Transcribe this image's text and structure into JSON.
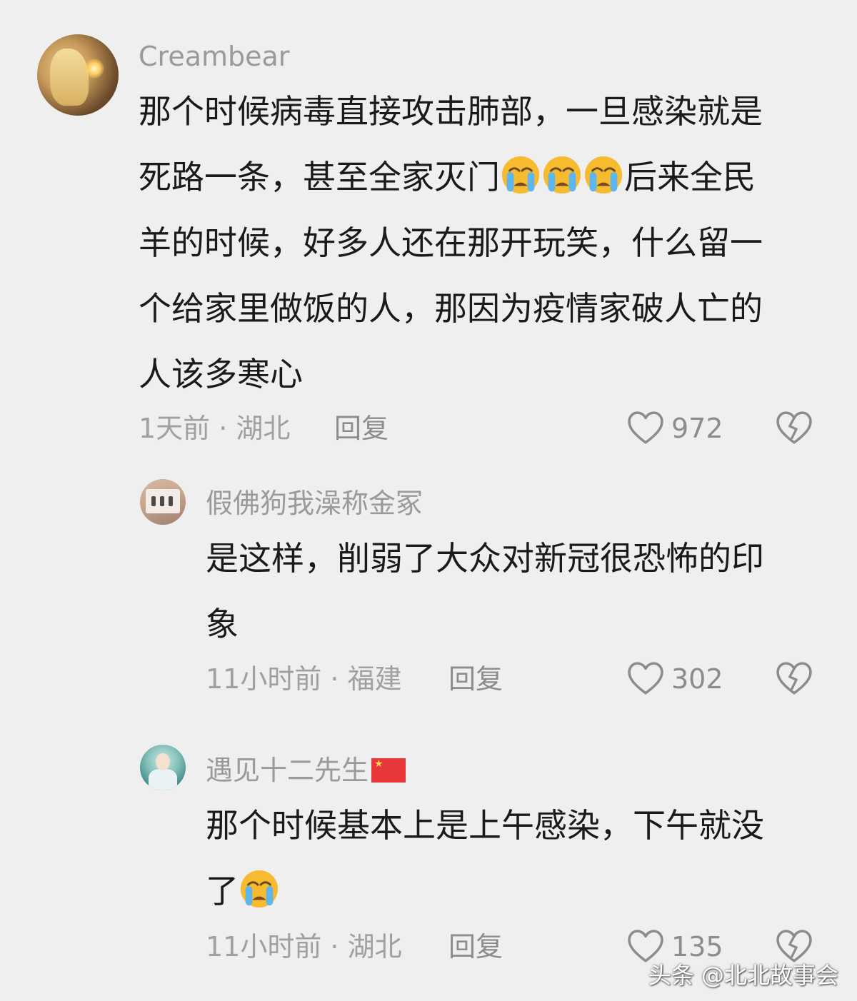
{
  "comments": [
    {
      "username": "Creambear",
      "text_lines": [
        "那个时候病毒直接攻击肺部，一旦感染就是",
        "死路一条，甚至全家灭门",
        "后来全民",
        "羊的时候，好多人还在那开玩笑，什么留一",
        "个给家里做饭的人，那因为疫情家破人亡的",
        "人该多寒心"
      ],
      "emoji_count": 3,
      "meta": "1天前 · 湖北",
      "reply_label": "回复",
      "likes": "972"
    },
    {
      "username": "假佛狗我澡称金冢",
      "text_lines": [
        "是这样，削弱了大众对新冠很恐怖的印",
        "象"
      ],
      "meta": "11小时前 · 福建",
      "reply_label": "回复",
      "likes": "302"
    },
    {
      "username": "遇见十二先生",
      "text_lines": [
        "那个时候基本上是上午感染，下午就没",
        "了"
      ],
      "emoji_count": 1,
      "meta": "11小时前 · 湖北",
      "reply_label": "回复",
      "likes": "135"
    }
  ],
  "watermark": "头条 @北北故事会",
  "icons": [
    "heart-icon",
    "broken-heart-icon",
    "crying-emoji-icon",
    "china-flag-icon"
  ],
  "colors": {
    "background": "#efefef",
    "username": "#9a9a9a",
    "meta": "#a0a0a0",
    "text": "#1a1a1a",
    "emoji": "#f5b82e"
  }
}
